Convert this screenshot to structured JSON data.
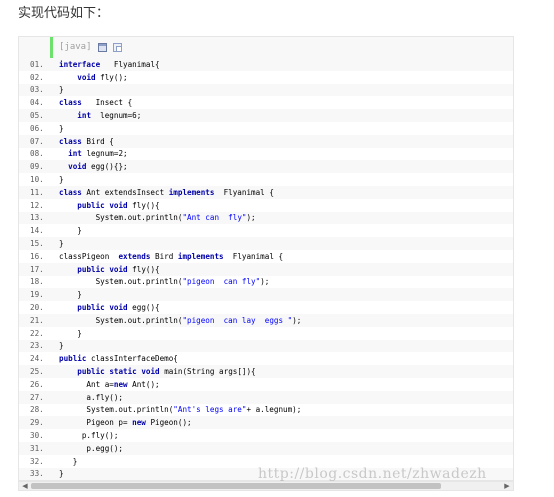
{
  "intro_text": "实现代码如下：",
  "toolbar": {
    "lang_label": "[java]",
    "view_icon": "view-source-icon",
    "copy_icon": "copy-icon"
  },
  "watermark": "http://blog.csdn.net/zhwadezh",
  "colors": {
    "gutter_bar": "#6ce26c",
    "keyword": "#0000aa",
    "string": "#0000ff",
    "line_number": "#5c5c5c"
  },
  "code_lines": [
    {
      "n": "01.",
      "s": [
        [
          "kw",
          "interface"
        ],
        [
          "",
          "   Flyanimal{"
        ]
      ]
    },
    {
      "n": "02.",
      "s": [
        [
          "",
          "    "
        ],
        [
          "kw",
          "void"
        ],
        [
          "",
          " fly();"
        ]
      ]
    },
    {
      "n": "03.",
      "s": [
        [
          "",
          "}"
        ]
      ]
    },
    {
      "n": "04.",
      "s": [
        [
          "kw",
          "class"
        ],
        [
          "",
          "   Insect {"
        ]
      ]
    },
    {
      "n": "05.",
      "s": [
        [
          "",
          "    "
        ],
        [
          "kw",
          "int"
        ],
        [
          "",
          "  legnum=6;"
        ]
      ]
    },
    {
      "n": "06.",
      "s": [
        [
          "",
          "}"
        ]
      ]
    },
    {
      "n": "07.",
      "s": [
        [
          "kw",
          "class"
        ],
        [
          "",
          " Bird {"
        ]
      ]
    },
    {
      "n": "08.",
      "s": [
        [
          "",
          "  "
        ],
        [
          "kw",
          "int"
        ],
        [
          "",
          " legnum=2;"
        ]
      ]
    },
    {
      "n": "09.",
      "s": [
        [
          "",
          "  "
        ],
        [
          "kw",
          "void"
        ],
        [
          "",
          " egg(){};"
        ]
      ]
    },
    {
      "n": "10.",
      "s": [
        [
          "",
          "}"
        ]
      ]
    },
    {
      "n": "11.",
      "s": [
        [
          "kw",
          "class"
        ],
        [
          "",
          " Ant extendsInsect "
        ],
        [
          "kw",
          "implements"
        ],
        [
          "",
          "  Flyanimal {"
        ]
      ]
    },
    {
      "n": "12.",
      "s": [
        [
          "",
          "    "
        ],
        [
          "kw",
          "public"
        ],
        [
          " ",
          " "
        ],
        [
          "kw",
          "void"
        ],
        [
          "",
          " fly(){"
        ]
      ]
    },
    {
      "n": "13.",
      "s": [
        [
          "",
          "        System.out.println("
        ],
        [
          "str",
          "\"Ant can  fly\""
        ],
        [
          "",
          ");"
        ]
      ]
    },
    {
      "n": "14.",
      "s": [
        [
          "",
          "    }"
        ]
      ]
    },
    {
      "n": "15.",
      "s": [
        [
          "",
          "}"
        ]
      ]
    },
    {
      "n": "16.",
      "s": [
        [
          "",
          "classPigeon  "
        ],
        [
          "kw",
          "extends"
        ],
        [
          "",
          " Bird "
        ],
        [
          "kw",
          "implements"
        ],
        [
          "",
          "  Flyanimal {"
        ]
      ]
    },
    {
      "n": "17.",
      "s": [
        [
          "",
          "    "
        ],
        [
          "kw",
          "public"
        ],
        [
          "",
          " "
        ],
        [
          "kw",
          "void"
        ],
        [
          "",
          " fly(){"
        ]
      ]
    },
    {
      "n": "18.",
      "s": [
        [
          "",
          "        System.out.println("
        ],
        [
          "str",
          "\"pigeon  can fly\""
        ],
        [
          "",
          ");"
        ]
      ]
    },
    {
      "n": "19.",
      "s": [
        [
          "",
          "    }"
        ]
      ]
    },
    {
      "n": "20.",
      "s": [
        [
          "",
          "    "
        ],
        [
          "kw",
          "public"
        ],
        [
          "",
          " "
        ],
        [
          "kw",
          "void"
        ],
        [
          "",
          " egg(){"
        ]
      ]
    },
    {
      "n": "21.",
      "s": [
        [
          "",
          "        System.out.println("
        ],
        [
          "str",
          "\"pigeon  can lay  eggs \""
        ],
        [
          "",
          ");"
        ]
      ]
    },
    {
      "n": "22.",
      "s": [
        [
          "",
          "    }"
        ]
      ]
    },
    {
      "n": "23.",
      "s": [
        [
          "",
          "}"
        ]
      ]
    },
    {
      "n": "24.",
      "s": [
        [
          "kw",
          "public"
        ],
        [
          "",
          " classInterfaceDemo{"
        ]
      ]
    },
    {
      "n": "25.",
      "s": [
        [
          "",
          "    "
        ],
        [
          "kw",
          "public"
        ],
        [
          "",
          " "
        ],
        [
          "kw",
          "static"
        ],
        [
          "",
          " "
        ],
        [
          "kw",
          "void"
        ],
        [
          "",
          " main(String args[]){"
        ]
      ]
    },
    {
      "n": "26.",
      "s": [
        [
          "",
          "      Ant a="
        ],
        [
          "kw",
          "new"
        ],
        [
          "",
          " Ant();"
        ]
      ]
    },
    {
      "n": "27.",
      "s": [
        [
          "",
          "      a.fly();"
        ]
      ]
    },
    {
      "n": "28.",
      "s": [
        [
          "",
          "      System.out.println("
        ],
        [
          "str",
          "\"Ant's legs are\""
        ],
        [
          "",
          "+ a.legnum);"
        ]
      ]
    },
    {
      "n": "29.",
      "s": [
        [
          "",
          "      Pigeon p= "
        ],
        [
          "kw",
          "new"
        ],
        [
          "",
          " Pigeon();"
        ]
      ]
    },
    {
      "n": "30.",
      "s": [
        [
          "",
          "     p.fly();"
        ]
      ]
    },
    {
      "n": "31.",
      "s": [
        [
          "",
          "      p.egg();"
        ]
      ]
    },
    {
      "n": "32.",
      "s": [
        [
          "",
          "   }"
        ]
      ]
    },
    {
      "n": "33.",
      "s": [
        [
          "",
          "}"
        ]
      ]
    }
  ]
}
